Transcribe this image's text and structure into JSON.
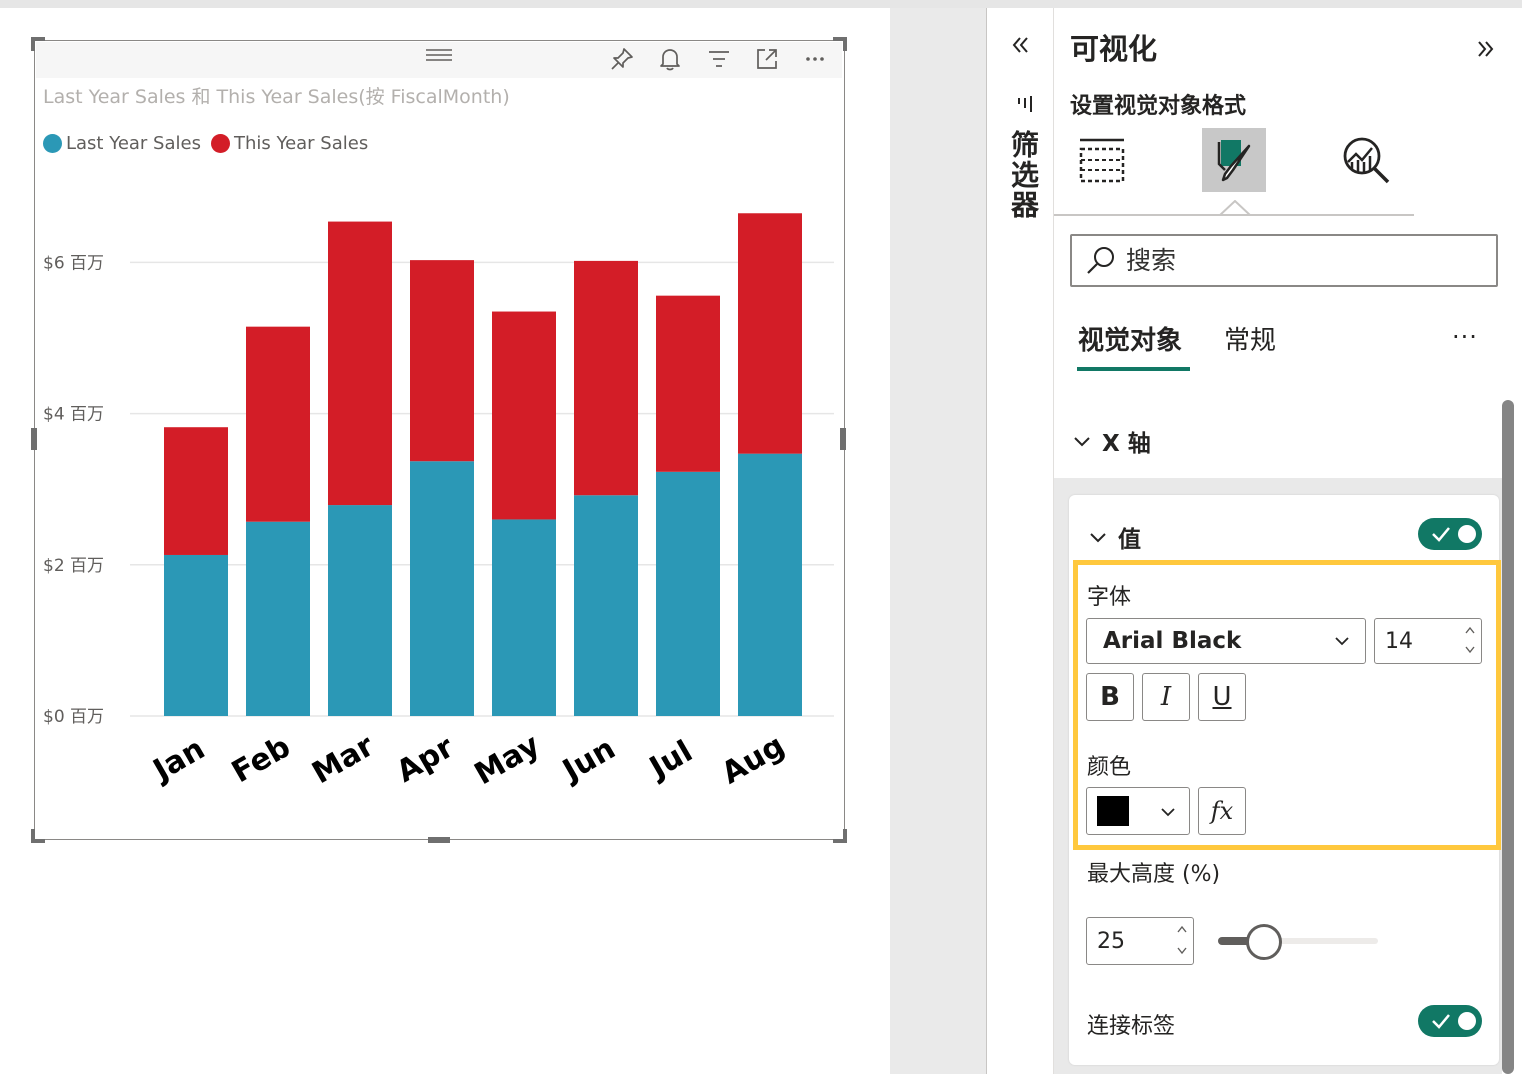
{
  "chart": {
    "title": "Last Year Sales 和 This Year Sales(按 FiscalMonth)",
    "legend": [
      {
        "name": "Last Year Sales",
        "color": "#2b98b6"
      },
      {
        "name": "This Year Sales",
        "color": "#d31d27"
      }
    ]
  },
  "chart_data": {
    "type": "bar",
    "stacked": true,
    "title": "Last Year Sales 和 This Year Sales(按 FiscalMonth)",
    "categories": [
      "Jan",
      "Feb",
      "Mar",
      "Apr",
      "May",
      "Jun",
      "Jul",
      "Aug"
    ],
    "series": [
      {
        "name": "Last Year Sales",
        "color": "#2b98b6",
        "values": [
          2.13,
          2.57,
          2.79,
          3.37,
          2.6,
          2.92,
          3.23,
          3.47
        ]
      },
      {
        "name": "This Year Sales",
        "color": "#d31d27",
        "values": [
          1.69,
          2.58,
          3.75,
          2.66,
          2.75,
          3.1,
          2.33,
          3.18
        ]
      }
    ],
    "y_ticks": [
      "$0 百万",
      "$2 百万",
      "$4 百万",
      "$6 百万"
    ],
    "y_tick_values": [
      0,
      2,
      4,
      6
    ],
    "ylim": [
      0,
      7.2
    ],
    "grid": true,
    "legend_position": "top-left",
    "x_label_style": {
      "font": "Arial Black",
      "size": 14,
      "color": "#000000",
      "rotation": -30
    }
  },
  "filters": {
    "label": "筛选器"
  },
  "pane": {
    "title": "可视化",
    "subtitle": "设置视觉对象格式",
    "tabs": [
      {
        "name": "build-visual-tab",
        "icon": "table-build-icon"
      },
      {
        "name": "format-visual-tab",
        "icon": "paintbrush-icon",
        "active": true
      },
      {
        "name": "analytics-tab",
        "icon": "analytics-magnifier-icon"
      }
    ],
    "search_placeholder": "搜索",
    "subtabs": {
      "visual": "视觉对象",
      "general": "常规"
    },
    "more": "···",
    "x_axis": {
      "label": "X 轴",
      "values": {
        "label": "值",
        "enabled": true,
        "font_label": "字体",
        "font": "Arial Black",
        "font_size": "14",
        "bold": "B",
        "italic": "I",
        "underline": "U",
        "color_label": "颜色",
        "color": "#000000",
        "fx": "fx",
        "max_height_label": "最大高度 (%)",
        "max_height": "25",
        "max_height_fraction": 0.25,
        "concat_label": "连接标签",
        "concat_enabled": true
      }
    }
  },
  "colors": {
    "accent": "#117865",
    "highlight": "#ffc83d"
  }
}
